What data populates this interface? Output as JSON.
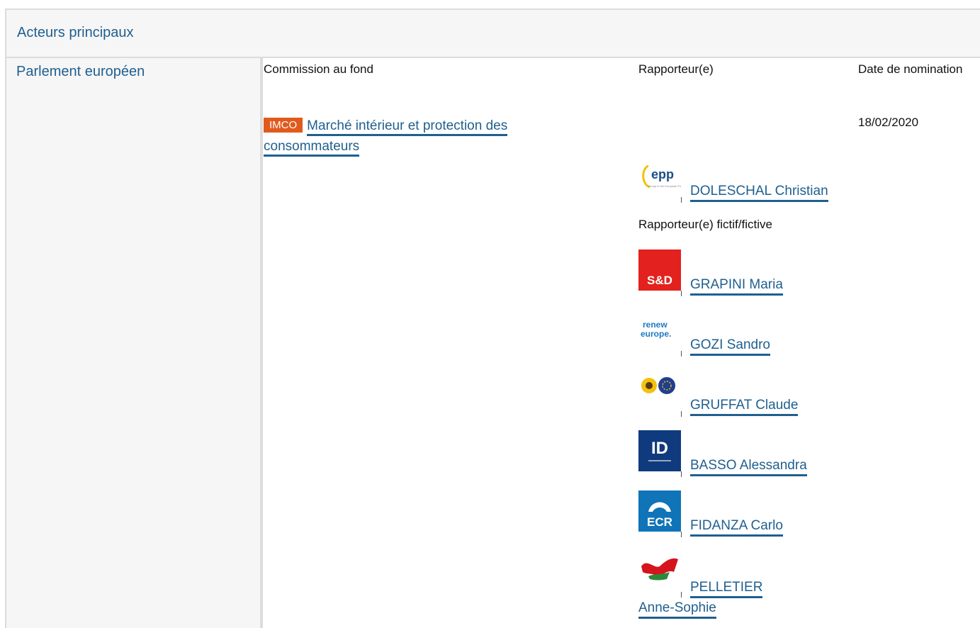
{
  "section": {
    "title": "Acteurs principaux"
  },
  "institution": "Parlement européen",
  "columns": {
    "committee": "Commission au fond",
    "rapporteur": "Rapporteur(e)",
    "date": "Date de nomination"
  },
  "committee": {
    "badge": "IMCO",
    "name": "Marché intérieur et protection des consommateurs",
    "badge_color": "#e05a1d"
  },
  "nomination_date": "18/02/2020",
  "rapporteur": {
    "group_logo": "epp-logo",
    "name": "DOLESCHAL Christian"
  },
  "shadow_heading": "Rapporteur(e) fictif/fictive",
  "shadow_rapporteurs": [
    {
      "group_logo": "sd-logo",
      "logo_text": "S&D",
      "name": "GRAPINI Maria"
    },
    {
      "group_logo": "renew-europe-logo",
      "logo_text": "renew europe.",
      "name": "GOZI Sandro"
    },
    {
      "group_logo": "greens-efa-logo",
      "name": "GRUFFAT Claude"
    },
    {
      "group_logo": "id-logo",
      "logo_text": "ID",
      "name": "BASSO Alessandra"
    },
    {
      "group_logo": "ecr-logo",
      "logo_text": "ECR",
      "name": "FIDANZA Carlo"
    },
    {
      "group_logo": "the-left-logo",
      "name_line1": "PELLETIER",
      "name_line2": "Anne-Sophie"
    }
  ],
  "colors": {
    "link": "#1f5f8f",
    "panel": "#f6f6f6"
  }
}
